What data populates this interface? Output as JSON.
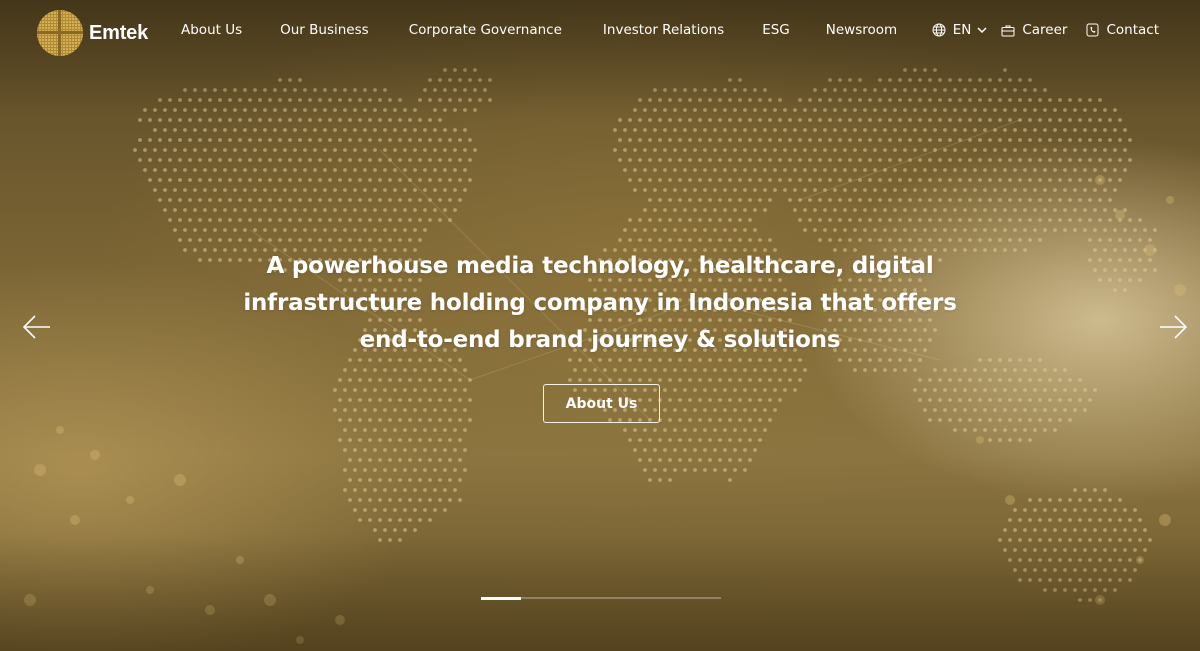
{
  "brand": {
    "name": "Emtek",
    "accent": "#c9a44a"
  },
  "nav": {
    "items": [
      {
        "label": "About Us"
      },
      {
        "label": "Our Business"
      },
      {
        "label": "Corporate Governance"
      },
      {
        "label": "Investor Relations"
      },
      {
        "label": "ESG"
      },
      {
        "label": "Newsroom"
      }
    ]
  },
  "utility": {
    "language": "EN",
    "career": "Career",
    "contact": "Contact",
    "icons": {
      "language": "globe-icon",
      "career": "briefcase-icon",
      "contact": "phone-icon"
    }
  },
  "hero": {
    "headline_lines": [
      "A powerhouse media technology, healthcare, digital",
      "infrastructure holding company in Indonesia that offers",
      "end-to-end brand journey & solutions"
    ],
    "cta_label": "About Us",
    "prev_icon": "arrow-left-icon",
    "next_icon": "arrow-right-icon",
    "slides_total": 6,
    "active_slide": 1
  }
}
